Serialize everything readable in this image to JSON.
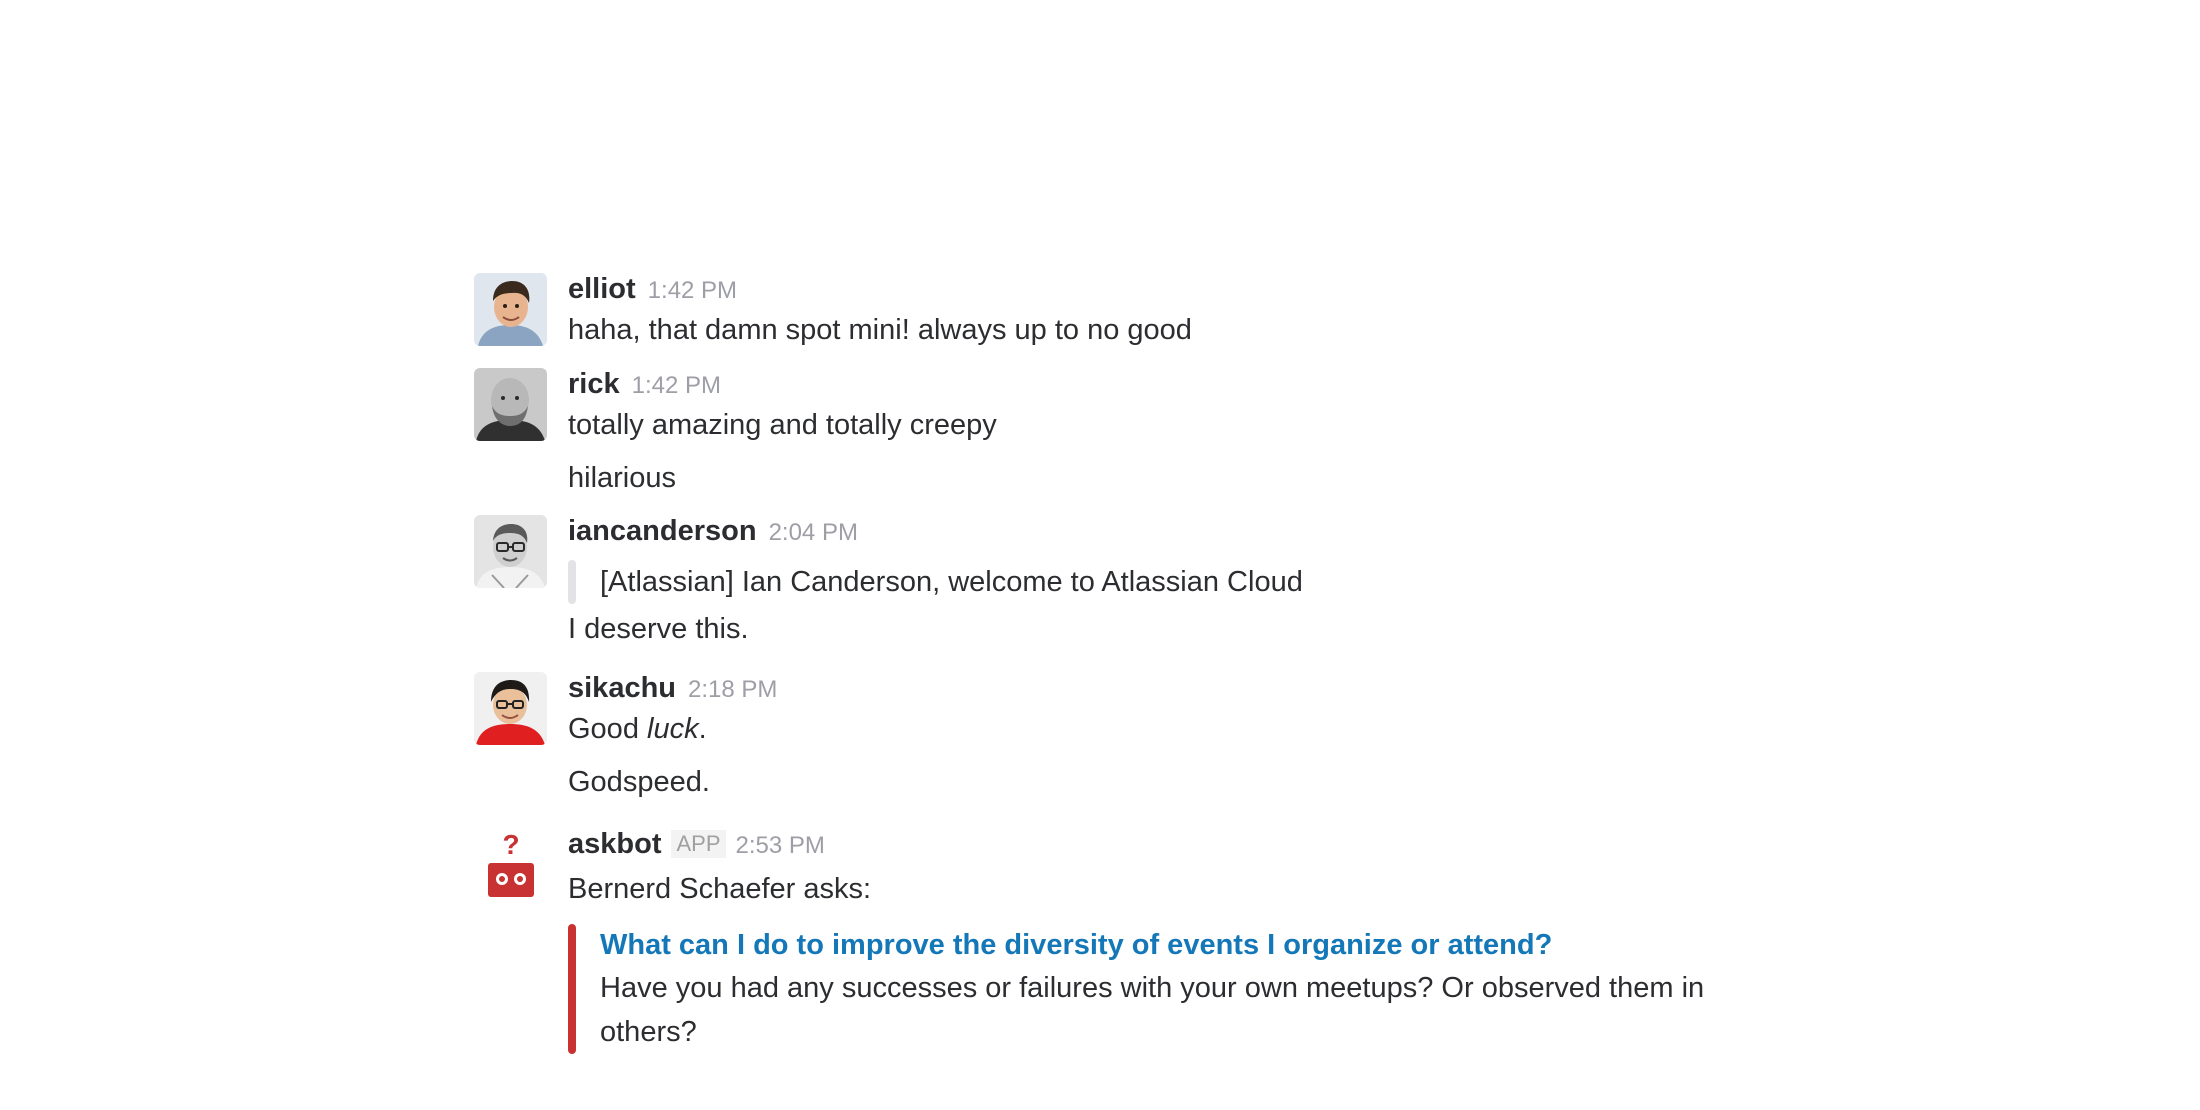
{
  "messages": [
    {
      "sender": "elliot",
      "time": "1:42 PM",
      "lines": [
        "haha, that damn spot mini! always up to no good"
      ]
    },
    {
      "sender": "rick",
      "time": "1:42 PM",
      "lines": [
        "totally amazing and totally creepy",
        "hilarious"
      ]
    },
    {
      "sender": "iancanderson",
      "time": "2:04 PM",
      "quote": "[Atlassian] Ian Canderson, welcome to Atlassian Cloud",
      "lines": [
        "I deserve this."
      ]
    },
    {
      "sender": "sikachu",
      "time": "2:18 PM",
      "lines_rich": [
        {
          "before": "Good ",
          "italic": "luck",
          "after": "."
        }
      ],
      "lines": [
        "Godspeed."
      ]
    },
    {
      "sender": "askbot",
      "badge": "APP",
      "time": "2:53 PM",
      "lines": [
        "Bernerd Schaefer asks:"
      ],
      "attachment": {
        "title": "What can I do to improve the diversity of events I organize or attend?",
        "body": "Have you had any successes or failures with your own meetups? Or observed them in others?",
        "accent_color": "#c83232",
        "title_color": "#1478b8"
      }
    }
  ],
  "icons": {
    "askbot_avatar": "question-robot-icon",
    "askbot_mark": "?"
  }
}
